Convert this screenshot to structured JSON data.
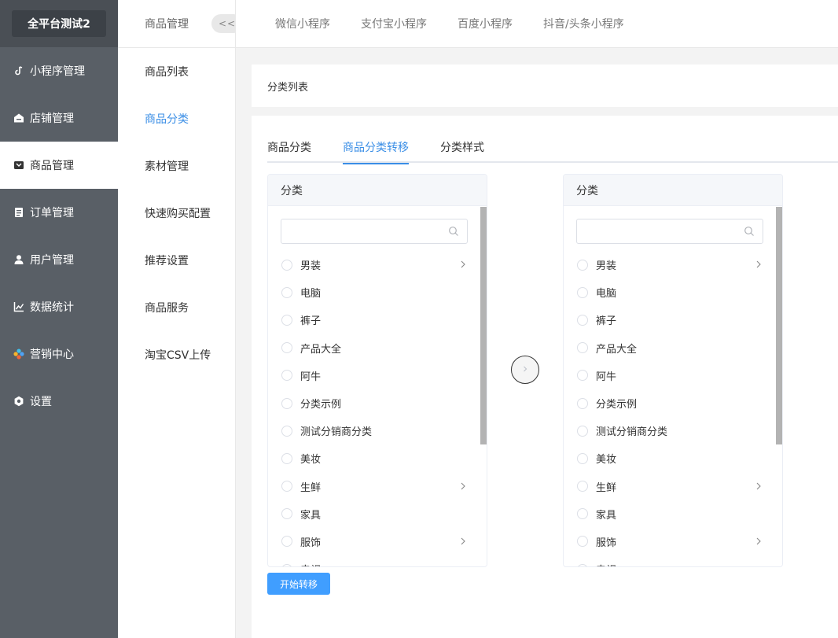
{
  "brand": "全平台测试2",
  "sidebar": {
    "items": [
      {
        "label": "小程序管理",
        "icon": "link-icon"
      },
      {
        "label": "店铺管理",
        "icon": "store-icon"
      },
      {
        "label": "商品管理",
        "icon": "goods-icon",
        "active": true
      },
      {
        "label": "订单管理",
        "icon": "order-icon"
      },
      {
        "label": "用户管理",
        "icon": "user-icon"
      },
      {
        "label": "数据统计",
        "icon": "chart-icon"
      },
      {
        "label": "营销中心",
        "icon": "marketing-icon"
      },
      {
        "label": "设置",
        "icon": "settings-icon"
      }
    ]
  },
  "subbar": {
    "title": "商品管理",
    "collapse": "<<",
    "items": [
      "商品列表",
      "商品分类",
      "素材管理",
      "快速购买配置",
      "推荐设置",
      "商品服务",
      "淘宝CSV上传"
    ]
  },
  "topbar": {
    "tabs": [
      "微信小程序",
      "支付宝小程序",
      "百度小程序",
      "抖音/头条小程序"
    ]
  },
  "panel": {
    "title": "分类列表",
    "tabs": [
      "商品分类",
      "商品分类转移",
      "分类样式"
    ],
    "active_tab": 1
  },
  "transfer": {
    "left": {
      "title": "分类",
      "search_placeholder": "",
      "items": [
        {
          "label": "男装",
          "has_children": true
        },
        {
          "label": "电脑",
          "has_children": false
        },
        {
          "label": "裤子",
          "has_children": false
        },
        {
          "label": "产品大全",
          "has_children": false
        },
        {
          "label": "阿牛",
          "has_children": false
        },
        {
          "label": "分类示例",
          "has_children": false
        },
        {
          "label": "测试分销商分类",
          "has_children": false
        },
        {
          "label": "美妆",
          "has_children": false
        },
        {
          "label": "生鲜",
          "has_children": true
        },
        {
          "label": "家具",
          "has_children": false
        },
        {
          "label": "服饰",
          "has_children": true
        },
        {
          "label": "电视",
          "has_children": false
        }
      ]
    },
    "right": {
      "title": "分类",
      "search_placeholder": "",
      "items": [
        {
          "label": "男装",
          "has_children": true
        },
        {
          "label": "电脑",
          "has_children": false
        },
        {
          "label": "裤子",
          "has_children": false
        },
        {
          "label": "产品大全",
          "has_children": false
        },
        {
          "label": "阿牛",
          "has_children": false
        },
        {
          "label": "分类示例",
          "has_children": false
        },
        {
          "label": "测试分销商分类",
          "has_children": false
        },
        {
          "label": "美妆",
          "has_children": false
        },
        {
          "label": "生鲜",
          "has_children": true
        },
        {
          "label": "家具",
          "has_children": false
        },
        {
          "label": "服饰",
          "has_children": true
        },
        {
          "label": "电视",
          "has_children": false
        }
      ]
    },
    "start_button": "开始转移"
  },
  "colors": {
    "sidebar_bg": "#595f66",
    "accent": "#3a8ee6",
    "primary_button": "#409eff"
  }
}
